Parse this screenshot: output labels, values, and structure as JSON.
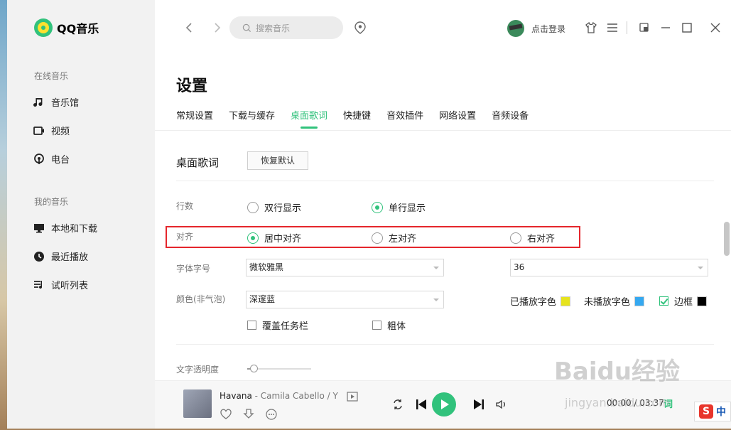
{
  "app": {
    "name": "QQ音乐"
  },
  "sidebar": {
    "sections": [
      {
        "title": "在线音乐",
        "items": [
          {
            "label": "音乐馆",
            "icon": "music-note-icon"
          },
          {
            "label": "视频",
            "icon": "video-icon"
          },
          {
            "label": "电台",
            "icon": "radio-icon"
          }
        ]
      },
      {
        "title": "我的音乐",
        "items": [
          {
            "label": "本地和下载",
            "icon": "monitor-icon"
          },
          {
            "label": "最近播放",
            "icon": "clock-icon"
          },
          {
            "label": "试听列表",
            "icon": "playlist-icon"
          }
        ]
      }
    ]
  },
  "topbar": {
    "search_placeholder": "搜索音乐",
    "login_label": "点击登录"
  },
  "settings": {
    "title": "设置",
    "tabs": [
      "常规设置",
      "下载与缓存",
      "桌面歌词",
      "快捷键",
      "音效插件",
      "网络设置",
      "音频设备"
    ],
    "active_tab": "桌面歌词",
    "section_title": "桌面歌词",
    "restore_label": "恢复默认",
    "rows": {
      "lines": {
        "label": "行数",
        "options": [
          "双行显示",
          "单行显示"
        ],
        "selected": "单行显示"
      },
      "align": {
        "label": "对齐",
        "options": [
          "居中对齐",
          "左对齐",
          "右对齐"
        ],
        "selected": "居中对齐"
      },
      "font": {
        "label": "字体字号",
        "family": "微软雅黑",
        "size": "36"
      },
      "color": {
        "label": "颜色(非气泡)",
        "scheme": "深邃蓝",
        "played_label": "已播放字色",
        "played_color": "#e6e31e",
        "unplayed_label": "未播放字色",
        "unplayed_color": "#35a8f0",
        "border_label": "边框",
        "border_color": "#000000",
        "border_checked": true
      },
      "taskbar": {
        "label": "覆盖任务栏",
        "checked": false
      },
      "bold": {
        "label": "粗体",
        "checked": false
      },
      "opacity": {
        "label": "文字透明度",
        "value": 0.1
      }
    }
  },
  "player": {
    "title": "Havana",
    "separator": "-",
    "artist": "Camila Cabello / Y",
    "time": "00:00 / 03:37",
    "lyric_btn": "词"
  },
  "overlay": {
    "watermark": "Baidu经验",
    "watermark_url": "jingyan.baidu.com",
    "ime_logo": "S",
    "ime_lang": "中"
  },
  "colors": {
    "accent": "#31c27c",
    "highlight_border": "#e5262c"
  }
}
